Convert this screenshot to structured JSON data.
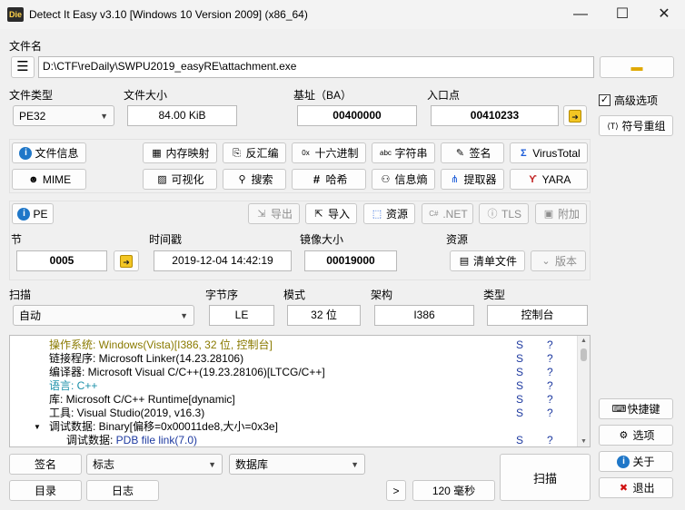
{
  "window": {
    "title": "Detect It Easy v3.10 [Windows 10 Version 2009] (x86_64)",
    "icon": "Die",
    "minimize": "—",
    "maximize": "☐",
    "close": "✕"
  },
  "file": {
    "label": "文件名",
    "path": "D:\\CTF\\reDaily\\SWPU2019_easyRE\\attachment.exe"
  },
  "info": {
    "type_label": "文件类型",
    "type_value": "PE32",
    "size_label": "文件大小",
    "size_value": "84.00 KiB",
    "base_label": "基址（BA）",
    "base_value": "00400000",
    "entry_label": "入口点",
    "entry_value": "00410233"
  },
  "tools": {
    "file_info": "文件信息",
    "memmap": "内存映射",
    "disasm": "反汇编",
    "hex": "十六进制",
    "strings": "字符串",
    "signature": "签名",
    "virustotal": "VirusTotal",
    "mime": "MIME",
    "visualize": "可视化",
    "search": "搜索",
    "hash": "哈希",
    "entropy": "信息熵",
    "extractor": "提取器",
    "yara": "YARA"
  },
  "pe": {
    "pe": "PE",
    "export": "导出",
    "import": "导入",
    "resource": "资源",
    "net": ".NET",
    "tls": "TLS",
    "overlay": "附加",
    "section_label": "节",
    "section_value": "0005",
    "time_label": "时间戳",
    "time_value": "2019-12-04 14:42:19",
    "image_label": "镜像大小",
    "image_value": "00019000",
    "res_label": "资源",
    "manifest": "清单文件",
    "version": "版本"
  },
  "scan": {
    "scan_label": "扫描",
    "scan_value": "自动",
    "endian_label": "字节序",
    "endian_value": "LE",
    "mode_label": "模式",
    "mode_value": "32 位",
    "arch_label": "架构",
    "arch_value": "I386",
    "type_label": "类型",
    "type_value": "控制台"
  },
  "results": [
    {
      "k": "操作系统: ",
      "v": "Windows(Vista)[I386, 32 位, 控制台]",
      "s1": "S",
      "s2": "?",
      "c": "#8a7a00",
      "kc": "#8a7a00"
    },
    {
      "k": "链接程序: ",
      "v": "Microsoft Linker(14.23.28106)",
      "s1": "S",
      "s2": "?",
      "c": "#000",
      "kc": "#000"
    },
    {
      "k": "编译器: ",
      "v": "Microsoft Visual C/C++(19.23.28106)[LTCG/C++]",
      "s1": "S",
      "s2": "?",
      "c": "#000",
      "kc": "#000"
    },
    {
      "k": "语言: ",
      "v": "C++",
      "s1": "S",
      "s2": "?",
      "c": "#1a8fa8",
      "kc": "#1a8fa8"
    },
    {
      "k": "库: ",
      "v": "Microsoft C/C++ Runtime[dynamic]",
      "s1": "S",
      "s2": "?",
      "c": "#000",
      "kc": "#000"
    },
    {
      "k": "工具: ",
      "v": "Visual Studio(2019, v16.3)",
      "s1": "S",
      "s2": "?",
      "c": "#000",
      "kc": "#000"
    },
    {
      "k": "调试数据: ",
      "v": "Binary[偏移=0x00011de8,大小=0x3e]",
      "s1": "",
      "s2": "",
      "c": "#000",
      "kc": "#000"
    },
    {
      "k": "调试数据: ",
      "v": "PDB file link(7.0)",
      "s1": "S",
      "s2": "?",
      "c": "#1e3aa0",
      "kc": "#000"
    }
  ],
  "bottom": {
    "signature": "签名",
    "flags": "标志",
    "database": "数据库",
    "dir": "目录",
    "log": "日志",
    "more": ">",
    "time": "120 毫秒",
    "scan": "扫描"
  },
  "side": {
    "advanced": "高级选项",
    "symbols": "符号重组",
    "shortcuts": "快捷键",
    "options": "选项",
    "about": "关于",
    "exit": "退出"
  }
}
